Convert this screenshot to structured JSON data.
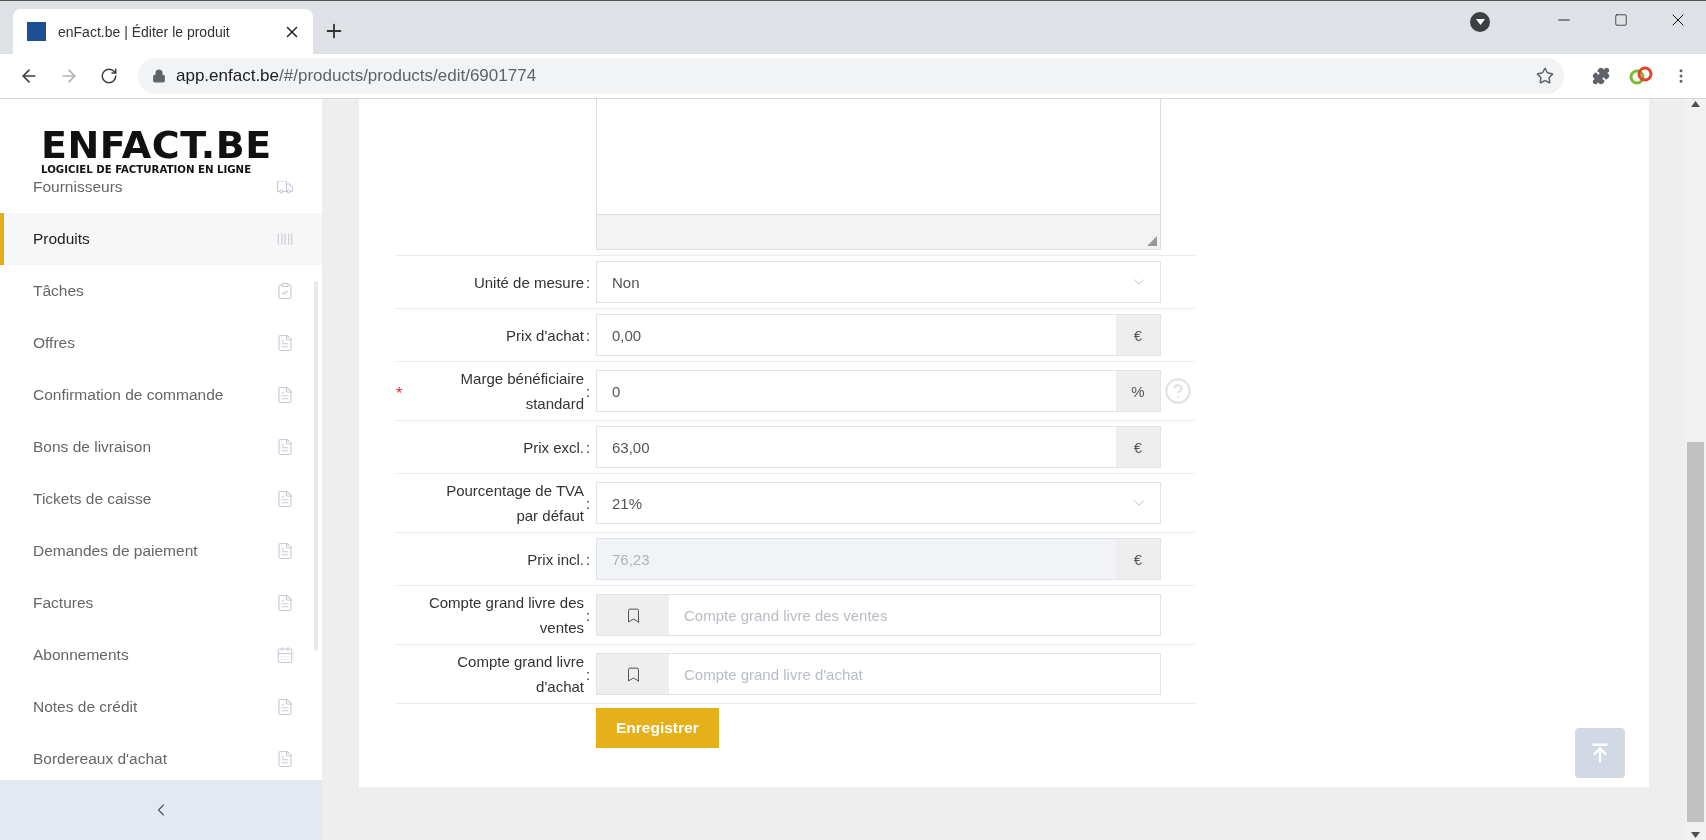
{
  "browser": {
    "tab_title": "enFact.be | Éditer le produit",
    "url_host": "app.enfact.be",
    "url_path": "/#/products/products/edit/6901774"
  },
  "sidebar": {
    "logo_title": "ENFACT.BE",
    "logo_subtitle": "LOGICIEL DE FACTURATION EN LIGNE",
    "items": [
      {
        "label": "Fournisseurs",
        "selected": false
      },
      {
        "label": "Produits",
        "selected": true
      },
      {
        "label": "Tâches",
        "selected": false
      },
      {
        "label": "Offres",
        "selected": false
      },
      {
        "label": "Confirmation de commande",
        "selected": false
      },
      {
        "label": "Bons de livraison",
        "selected": false
      },
      {
        "label": "Tickets de caisse",
        "selected": false
      },
      {
        "label": "Demandes de paiement",
        "selected": false
      },
      {
        "label": "Factures",
        "selected": false
      },
      {
        "label": "Abonnements",
        "selected": false
      },
      {
        "label": "Notes de crédit",
        "selected": false
      },
      {
        "label": "Bordereaux d'achat",
        "selected": false
      }
    ]
  },
  "form": {
    "fields": [
      {
        "kind": "select",
        "label": "Unité de mesure",
        "colon": ":",
        "value": "Non",
        "required": false
      },
      {
        "kind": "addon",
        "label": "Prix d'achat",
        "colon": ":",
        "value": "0,00",
        "addon": "€",
        "required": false,
        "disabled": false,
        "help": false
      },
      {
        "kind": "addon",
        "label": "Marge bénéficiaire standard",
        "colon": ":",
        "value": "0",
        "addon": "%",
        "required": true,
        "disabled": false,
        "help": true
      },
      {
        "kind": "addon",
        "label": "Prix excl.",
        "colon": ":",
        "value": "63,00",
        "addon": "€",
        "required": false,
        "disabled": false,
        "help": false
      },
      {
        "kind": "select",
        "label": "Pourcentage de TVA par défaut",
        "colon": ":",
        "value": "21%",
        "required": false
      },
      {
        "kind": "addon",
        "label": "Prix incl.",
        "colon": ":",
        "value": "76,23",
        "addon": "€",
        "required": false,
        "disabled": true,
        "help": false
      },
      {
        "kind": "account",
        "label": "Compte grand livre des ventes",
        "colon": ":",
        "placeholder": "Compte grand livre des ventes",
        "required": false
      },
      {
        "kind": "account",
        "label": "Compte grand livre d'achat",
        "colon": ":",
        "placeholder": "Compte grand livre d'achat",
        "required": false
      }
    ],
    "required_symbol": "*",
    "save_button": "Enregistrer"
  }
}
